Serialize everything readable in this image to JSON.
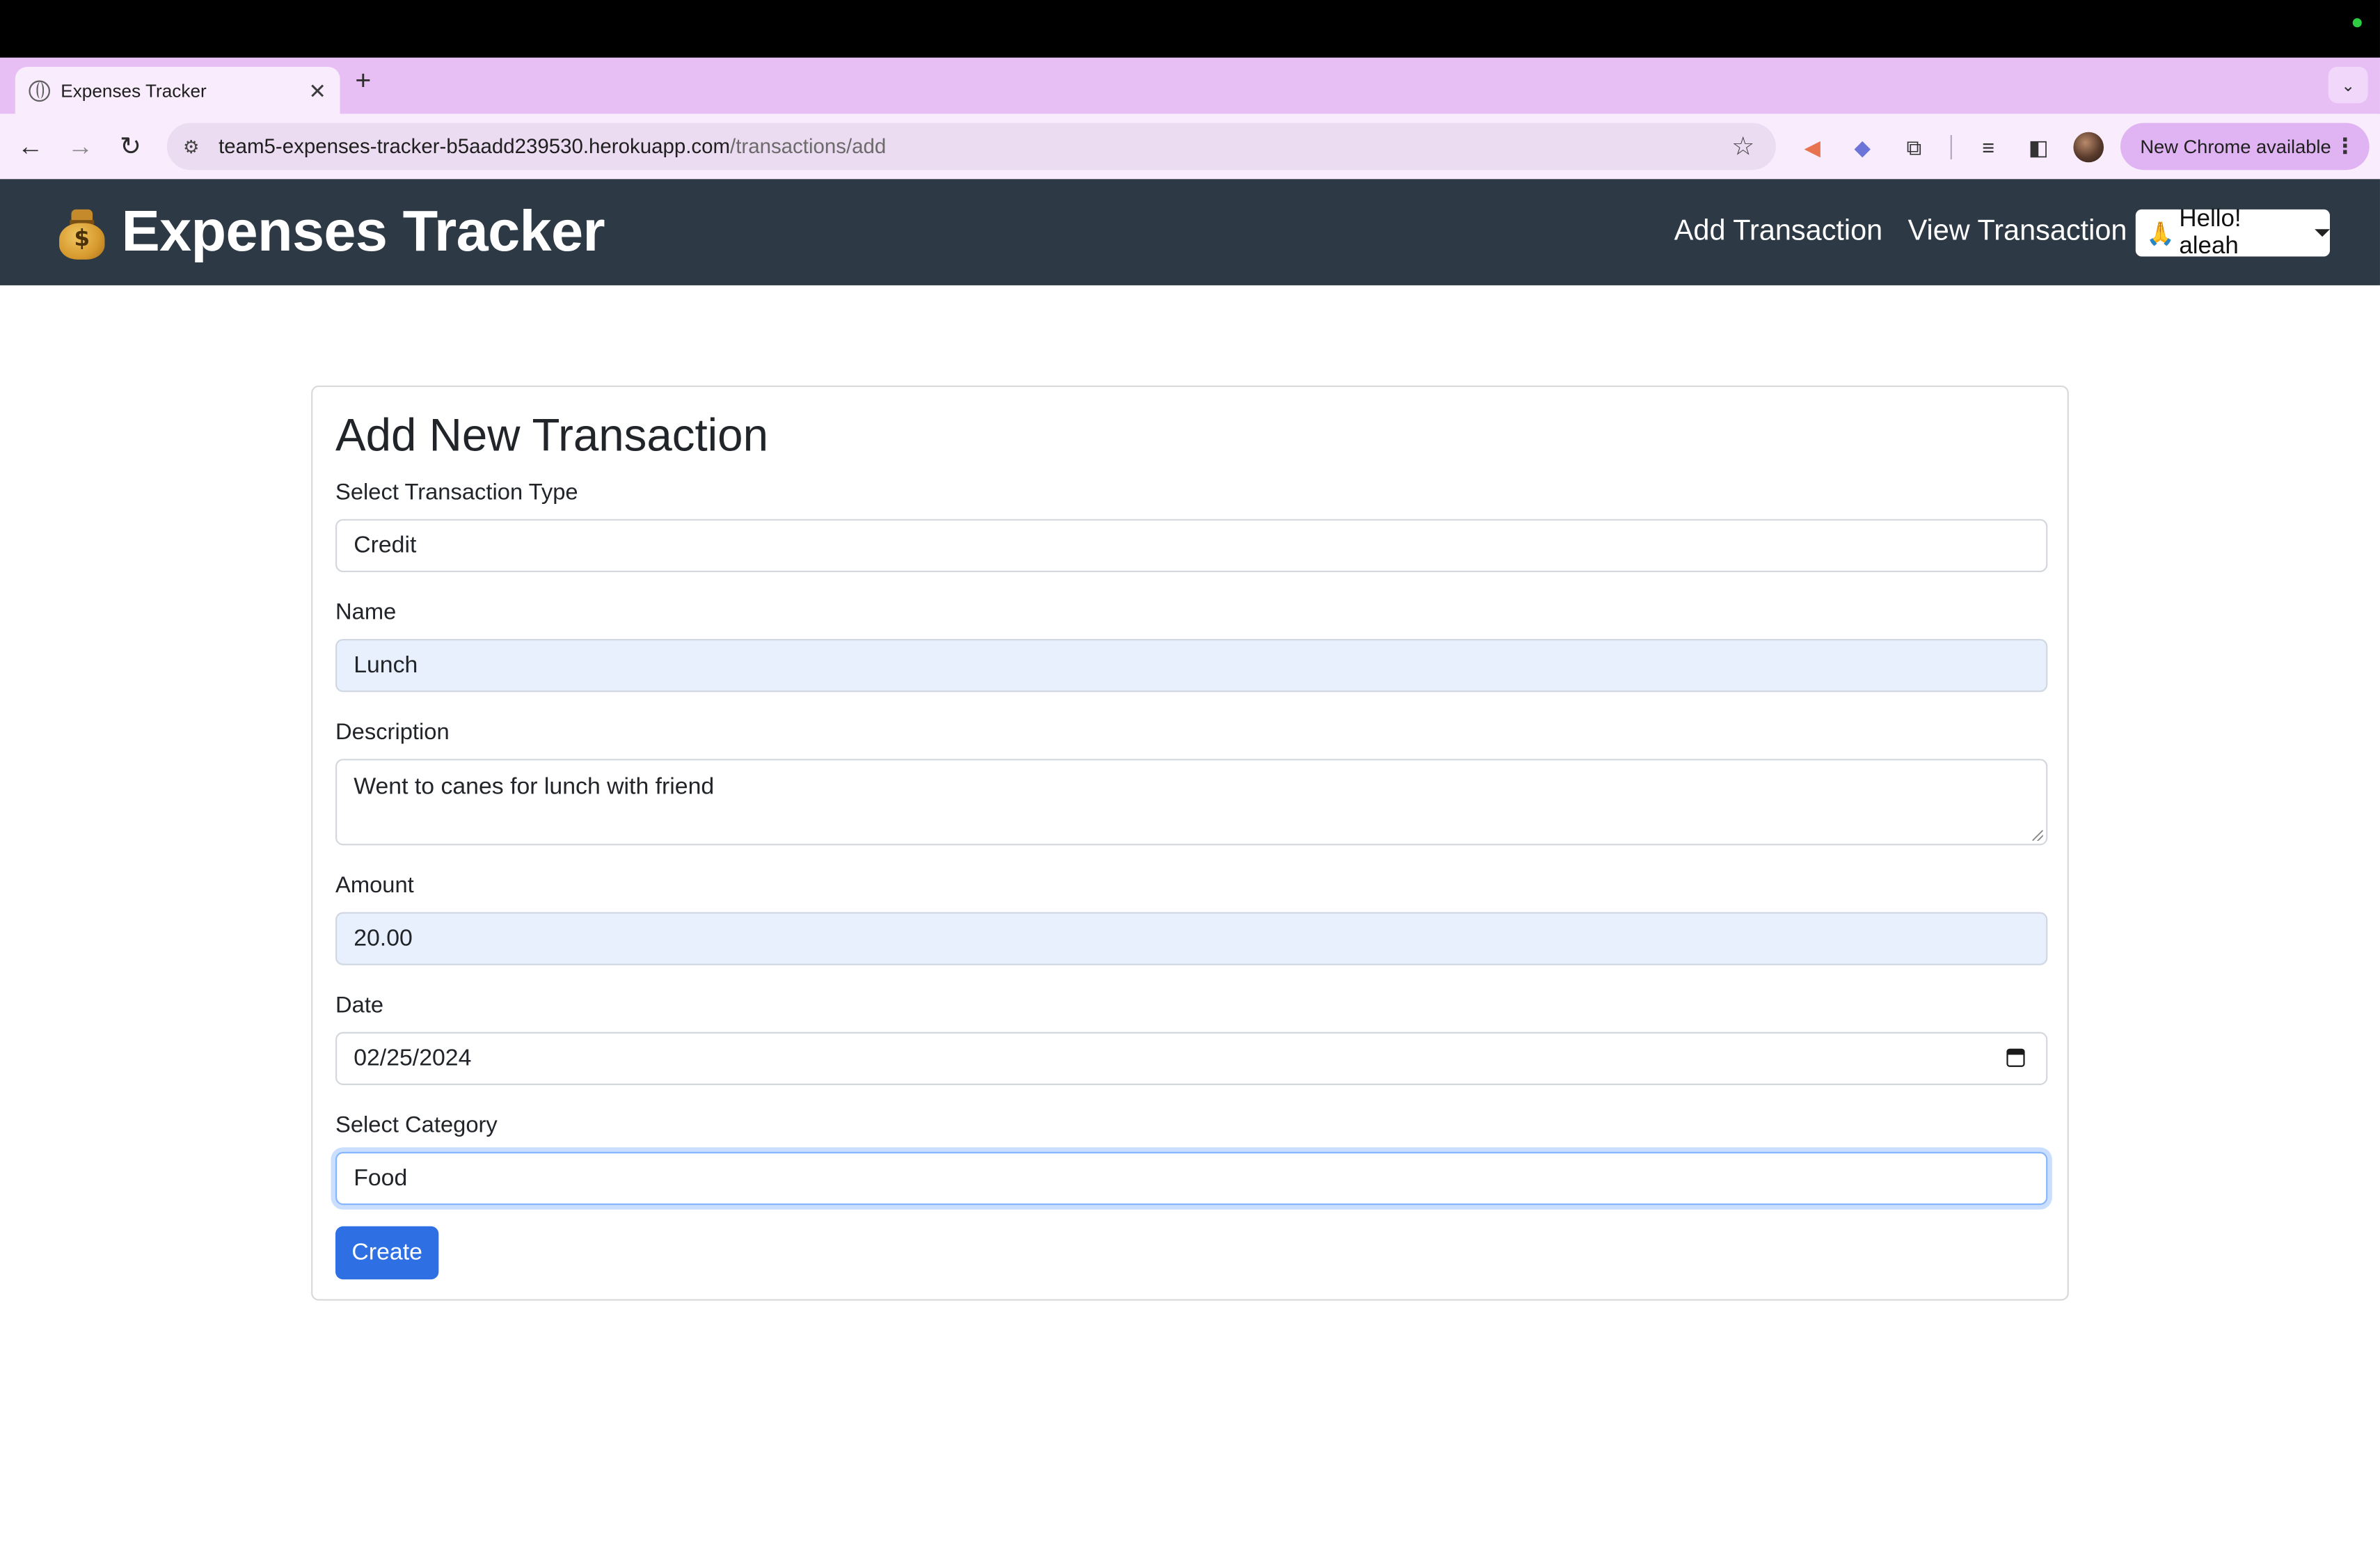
{
  "browser": {
    "tab_title": "Expenses Tracker",
    "tab_close": "✕",
    "new_tab": "+",
    "tab_search_chevron": "⌄",
    "url_host": "team5-expenses-tracker-b5aadd239530.herokuapp.com",
    "url_path": "/transactions/add",
    "update_label": "New Chrome available",
    "kebab": "⋮",
    "back": "←",
    "forward": "→",
    "reload": "↻",
    "star": "☆"
  },
  "navbar": {
    "brand": "Expenses Tracker",
    "brand_icon": "money-bag",
    "brand_symbol": "$",
    "links": [
      "Add Transaction",
      "View Transaction"
    ],
    "user_greeting": "Hello! aleah",
    "user_icon": "🙏"
  },
  "form": {
    "title": "Add New Transaction",
    "type_label": "Select Transaction Type",
    "type_value": "Credit",
    "name_label": "Name",
    "name_value": "Lunch",
    "description_label": "Description",
    "description_value": "Went to canes for lunch with friend",
    "amount_label": "Amount",
    "amount_value": "20.00",
    "date_label": "Date",
    "date_value": "02/25/2024",
    "category_label": "Select Category",
    "category_value": "Food",
    "submit_label": "Create"
  },
  "colors": {
    "navbar_bg": "#2d3a45",
    "tab_strip_bg": "#e8bff5",
    "button_primary": "#2f6fe4",
    "autofill_bg": "#e8f0fe"
  }
}
